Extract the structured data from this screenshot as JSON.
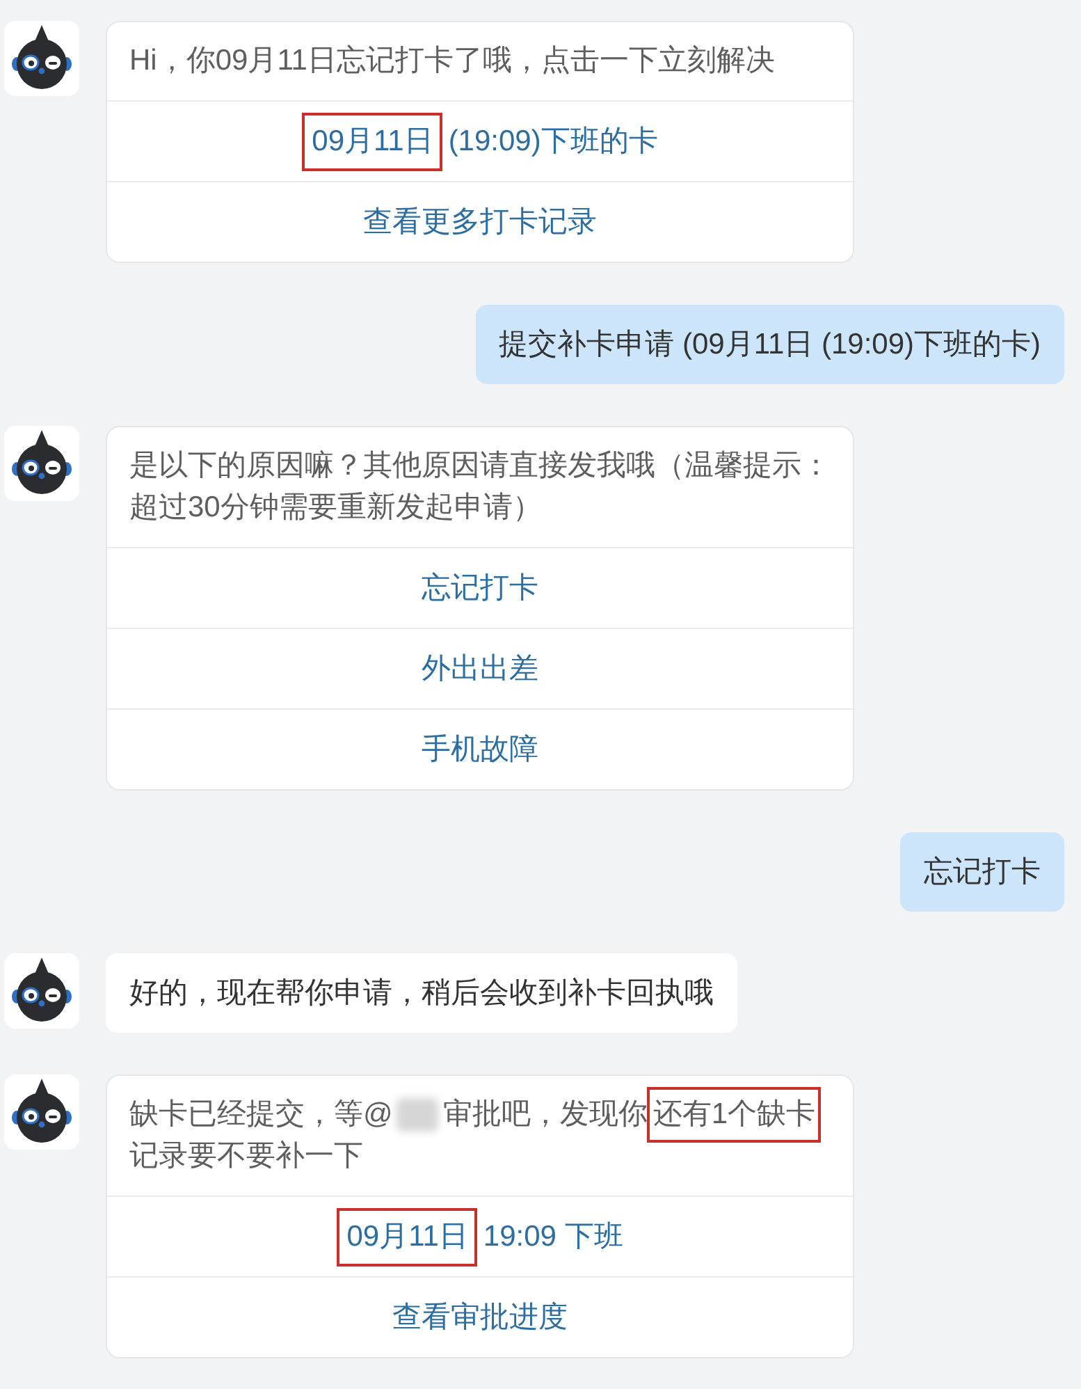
{
  "messages": [
    {
      "from_me": false,
      "kind": "card",
      "segments": [
        {
          "kind": "text",
          "text": "Hi，你09月11日忘记打卡了哦，点击一下立刻解决"
        }
      ],
      "actions": [
        {
          "segments": [
            {
              "kind": "marked",
              "text": "09月11日"
            },
            {
              "kind": "text",
              "text": "(19:09)下班的卡"
            }
          ]
        },
        {
          "segments": [
            {
              "kind": "text",
              "text": "查看更多打卡记录"
            }
          ]
        }
      ]
    },
    {
      "from_me": true,
      "kind": "text",
      "text": "提交补卡申请 (09月11日 (19:09)下班的卡)"
    },
    {
      "from_me": false,
      "kind": "card",
      "segments": [
        {
          "kind": "text",
          "text": "是以下的原因嘛？其他原因请直接发我哦（温馨提示：超过30分钟需要重新发起申请）"
        }
      ],
      "actions": [
        {
          "segments": [
            {
              "kind": "text",
              "text": "忘记打卡"
            }
          ]
        },
        {
          "segments": [
            {
              "kind": "text",
              "text": "外出出差"
            }
          ]
        },
        {
          "segments": [
            {
              "kind": "text",
              "text": "手机故障"
            }
          ]
        }
      ]
    },
    {
      "from_me": true,
      "kind": "text",
      "text": "忘记打卡"
    },
    {
      "from_me": false,
      "kind": "text",
      "text": "好的，现在帮你申请，稍后会收到补卡回执哦"
    },
    {
      "from_me": false,
      "kind": "card",
      "segments": [
        {
          "kind": "text",
          "text": "缺卡已经提交，等@"
        },
        {
          "kind": "redacted"
        },
        {
          "kind": "text",
          "text": "审批吧，发现你"
        },
        {
          "kind": "marked",
          "text": "还有1个缺卡"
        },
        {
          "kind": "text",
          "text": "记录要不要补一下"
        }
      ],
      "actions": [
        {
          "segments": [
            {
              "kind": "marked",
              "text": "09月11日"
            },
            {
              "kind": "text",
              "text": "19:09 下班"
            }
          ]
        },
        {
          "segments": [
            {
              "kind": "text",
              "text": "查看审批进度"
            }
          ]
        }
      ]
    }
  ]
}
